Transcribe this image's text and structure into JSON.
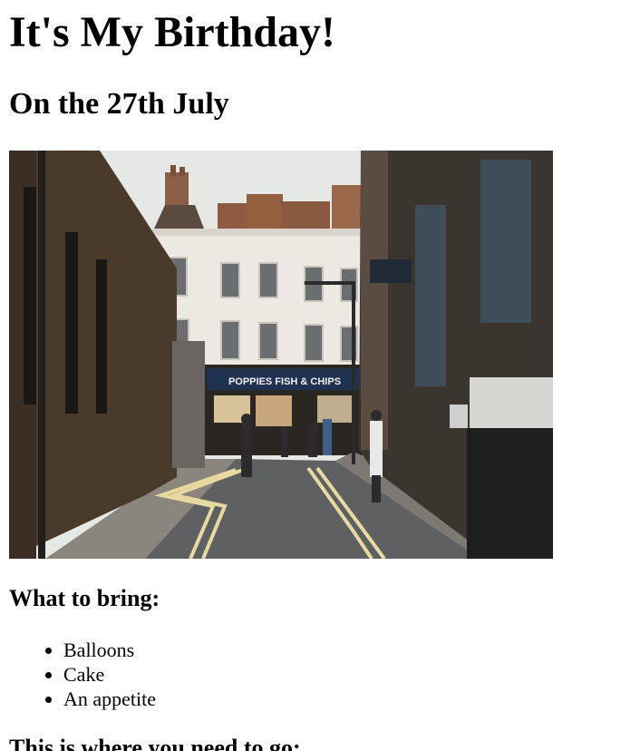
{
  "page": {
    "title": "It's My Birthday!",
    "date_heading": "On the 27th July",
    "bring_heading": "What to bring:",
    "bring_items": [
      {
        "label": "Balloons"
      },
      {
        "label": "Cake"
      },
      {
        "label": "An appetite"
      }
    ],
    "where_heading": "This is where you need to go:"
  },
  "photo": {
    "subject": "city-street-photo",
    "shop_sign": "POPPIES FISH & CHIPS",
    "colors": {
      "sky": "#e6e8e6",
      "brick": "#4a3a2c",
      "white_building": "#ece9e2",
      "road": "#5f6061",
      "pavement": "#8a857d",
      "road_lines": "#e8d9a0",
      "shopfront": "#1f3250"
    }
  }
}
